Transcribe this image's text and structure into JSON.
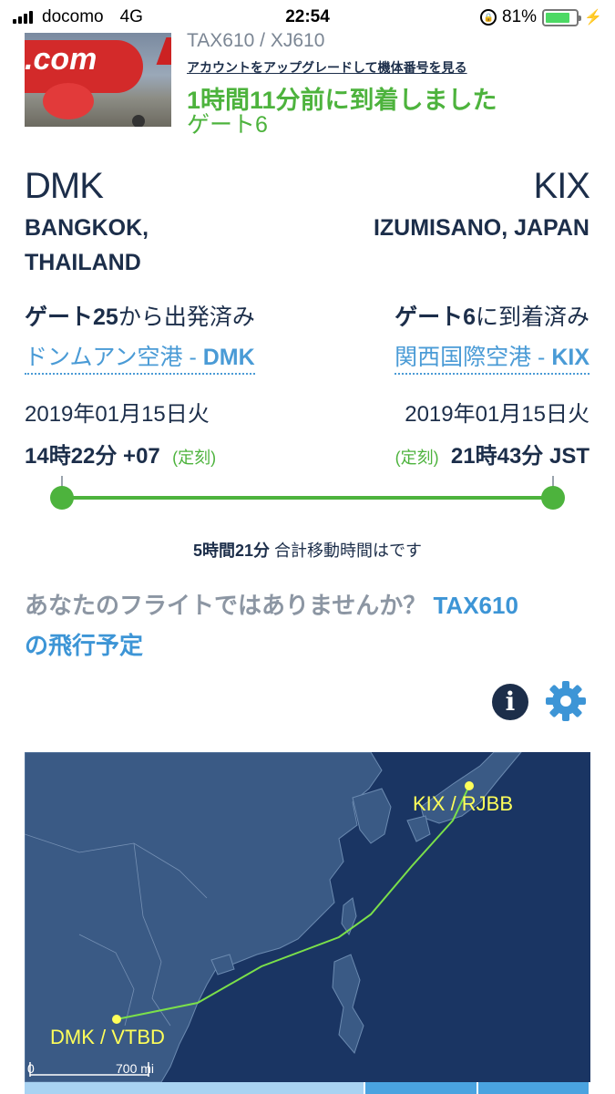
{
  "status_bar": {
    "carrier": "docomo",
    "network": "4G",
    "time": "22:54",
    "battery_percent": "81%",
    "battery_level": 0.81
  },
  "flight": {
    "codes": "TAX610 / XJ610",
    "upgrade_link": "アカウントをアップグレードして機体番号を見る",
    "status": "1時間11分前に到着しました",
    "arrival_gate": "ゲート6",
    "thumbnail_text": ".com"
  },
  "origin": {
    "code": "DMK",
    "city_line1": "BANGKOK,",
    "city_line2": "THAILAND",
    "gate_bold": "ゲート25",
    "gate_rest": "から出発済み",
    "airport_name": "ドンムアン空港 - ",
    "airport_code": "DMK",
    "date": "2019年01月15日火",
    "time": "14時22分 +07",
    "ontime": "(定刻)"
  },
  "destination": {
    "code": "KIX",
    "city": "IZUMISANO, JAPAN",
    "gate_bold": "ゲート6",
    "gate_rest": "に到着済み",
    "airport_name": "関西国際空港 - ",
    "airport_code": "KIX",
    "date": "2019年01月15日火",
    "time": "21時43分 JST",
    "ontime": "(定刻)"
  },
  "progress": {
    "fraction": 1.0,
    "total_bold": "5時間21分",
    "total_rest": " 合計移動時間はです"
  },
  "not_your_flight": {
    "question": "あなたのフライトではありませんか？",
    "link_part1": "TAX610",
    "link_part2": "の飛行予定"
  },
  "map": {
    "origin_label": "DMK / VTBD",
    "destination_label": "KIX / RJBB",
    "scale_zero": "0",
    "scale_label": "700 mi",
    "route_color": "#7be04a",
    "water_color": "#1a3563",
    "land_color": "#3a5a85"
  },
  "icons": {
    "info": "info-icon",
    "settings": "gear-icon"
  }
}
